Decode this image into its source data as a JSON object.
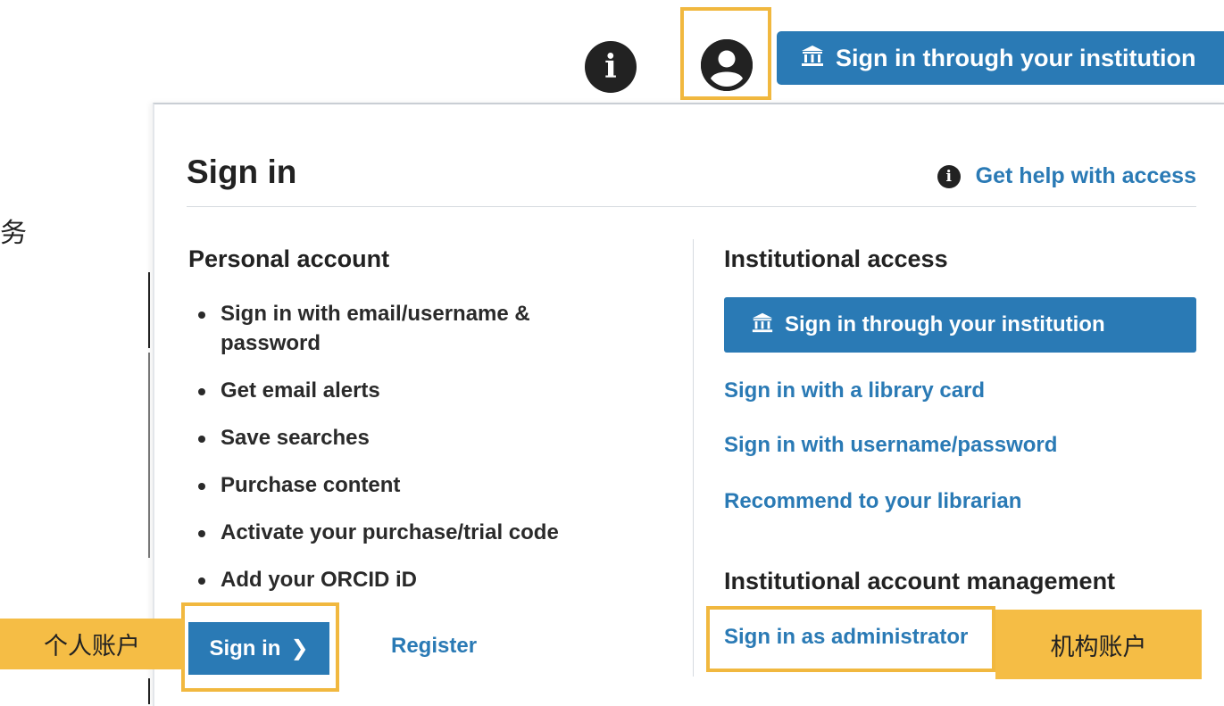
{
  "background": {
    "cjk_fragment": "服务"
  },
  "header": {
    "info_icon": "info-icon",
    "account_icon": "account-icon",
    "institution_button": "Sign in through your institution"
  },
  "panel": {
    "title": "Sign in",
    "help_link": "Get help with access",
    "personal": {
      "heading": "Personal account",
      "features": [
        "Sign in with email/username & password",
        "Get email alerts",
        "Save searches",
        "Purchase content",
        "Activate your purchase/trial code",
        "Add your ORCID iD"
      ],
      "sign_in_button": "Sign in",
      "register_link": "Register"
    },
    "institutional": {
      "heading": "Institutional access",
      "sign_in_institution_button": "Sign in through your institution",
      "library_card_link": "Sign in with a library card",
      "username_password_link": "Sign in with username/password",
      "recommend_link": "Recommend to your librarian",
      "management_heading": "Institutional account management",
      "admin_link": "Sign in as administrator"
    }
  },
  "annotations": {
    "personal_label": "个人账户",
    "institution_label": "机构账户",
    "highlight_color": "#f1b83f"
  },
  "colors": {
    "brand_blue": "#2a7ab5",
    "text": "#2a2a2a"
  }
}
